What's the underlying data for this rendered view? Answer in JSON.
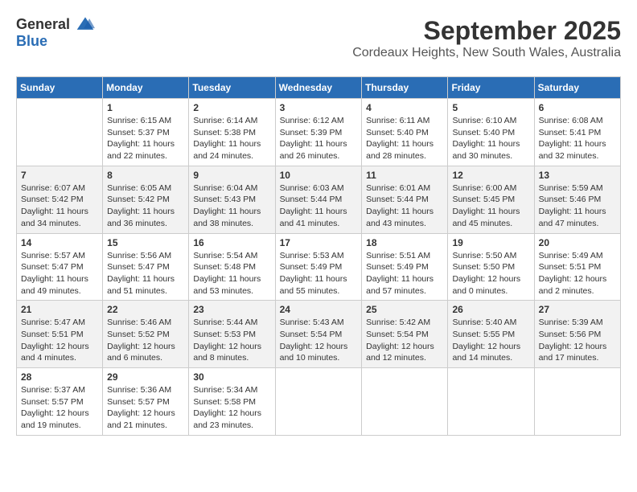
{
  "logo": {
    "line1": "General",
    "line2": "Blue"
  },
  "title": "September 2025",
  "location": "Cordeaux Heights, New South Wales, Australia",
  "days_of_week": [
    "Sunday",
    "Monday",
    "Tuesday",
    "Wednesday",
    "Thursday",
    "Friday",
    "Saturday"
  ],
  "weeks": [
    [
      {
        "day": "",
        "text": ""
      },
      {
        "day": "1",
        "text": "Sunrise: 6:15 AM\nSunset: 5:37 PM\nDaylight: 11 hours\nand 22 minutes."
      },
      {
        "day": "2",
        "text": "Sunrise: 6:14 AM\nSunset: 5:38 PM\nDaylight: 11 hours\nand 24 minutes."
      },
      {
        "day": "3",
        "text": "Sunrise: 6:12 AM\nSunset: 5:39 PM\nDaylight: 11 hours\nand 26 minutes."
      },
      {
        "day": "4",
        "text": "Sunrise: 6:11 AM\nSunset: 5:40 PM\nDaylight: 11 hours\nand 28 minutes."
      },
      {
        "day": "5",
        "text": "Sunrise: 6:10 AM\nSunset: 5:40 PM\nDaylight: 11 hours\nand 30 minutes."
      },
      {
        "day": "6",
        "text": "Sunrise: 6:08 AM\nSunset: 5:41 PM\nDaylight: 11 hours\nand 32 minutes."
      }
    ],
    [
      {
        "day": "7",
        "text": "Sunrise: 6:07 AM\nSunset: 5:42 PM\nDaylight: 11 hours\nand 34 minutes."
      },
      {
        "day": "8",
        "text": "Sunrise: 6:05 AM\nSunset: 5:42 PM\nDaylight: 11 hours\nand 36 minutes."
      },
      {
        "day": "9",
        "text": "Sunrise: 6:04 AM\nSunset: 5:43 PM\nDaylight: 11 hours\nand 38 minutes."
      },
      {
        "day": "10",
        "text": "Sunrise: 6:03 AM\nSunset: 5:44 PM\nDaylight: 11 hours\nand 41 minutes."
      },
      {
        "day": "11",
        "text": "Sunrise: 6:01 AM\nSunset: 5:44 PM\nDaylight: 11 hours\nand 43 minutes."
      },
      {
        "day": "12",
        "text": "Sunrise: 6:00 AM\nSunset: 5:45 PM\nDaylight: 11 hours\nand 45 minutes."
      },
      {
        "day": "13",
        "text": "Sunrise: 5:59 AM\nSunset: 5:46 PM\nDaylight: 11 hours\nand 47 minutes."
      }
    ],
    [
      {
        "day": "14",
        "text": "Sunrise: 5:57 AM\nSunset: 5:47 PM\nDaylight: 11 hours\nand 49 minutes."
      },
      {
        "day": "15",
        "text": "Sunrise: 5:56 AM\nSunset: 5:47 PM\nDaylight: 11 hours\nand 51 minutes."
      },
      {
        "day": "16",
        "text": "Sunrise: 5:54 AM\nSunset: 5:48 PM\nDaylight: 11 hours\nand 53 minutes."
      },
      {
        "day": "17",
        "text": "Sunrise: 5:53 AM\nSunset: 5:49 PM\nDaylight: 11 hours\nand 55 minutes."
      },
      {
        "day": "18",
        "text": "Sunrise: 5:51 AM\nSunset: 5:49 PM\nDaylight: 11 hours\nand 57 minutes."
      },
      {
        "day": "19",
        "text": "Sunrise: 5:50 AM\nSunset: 5:50 PM\nDaylight: 12 hours\nand 0 minutes."
      },
      {
        "day": "20",
        "text": "Sunrise: 5:49 AM\nSunset: 5:51 PM\nDaylight: 12 hours\nand 2 minutes."
      }
    ],
    [
      {
        "day": "21",
        "text": "Sunrise: 5:47 AM\nSunset: 5:51 PM\nDaylight: 12 hours\nand 4 minutes."
      },
      {
        "day": "22",
        "text": "Sunrise: 5:46 AM\nSunset: 5:52 PM\nDaylight: 12 hours\nand 6 minutes."
      },
      {
        "day": "23",
        "text": "Sunrise: 5:44 AM\nSunset: 5:53 PM\nDaylight: 12 hours\nand 8 minutes."
      },
      {
        "day": "24",
        "text": "Sunrise: 5:43 AM\nSunset: 5:54 PM\nDaylight: 12 hours\nand 10 minutes."
      },
      {
        "day": "25",
        "text": "Sunrise: 5:42 AM\nSunset: 5:54 PM\nDaylight: 12 hours\nand 12 minutes."
      },
      {
        "day": "26",
        "text": "Sunrise: 5:40 AM\nSunset: 5:55 PM\nDaylight: 12 hours\nand 14 minutes."
      },
      {
        "day": "27",
        "text": "Sunrise: 5:39 AM\nSunset: 5:56 PM\nDaylight: 12 hours\nand 17 minutes."
      }
    ],
    [
      {
        "day": "28",
        "text": "Sunrise: 5:37 AM\nSunset: 5:57 PM\nDaylight: 12 hours\nand 19 minutes."
      },
      {
        "day": "29",
        "text": "Sunrise: 5:36 AM\nSunset: 5:57 PM\nDaylight: 12 hours\nand 21 minutes."
      },
      {
        "day": "30",
        "text": "Sunrise: 5:34 AM\nSunset: 5:58 PM\nDaylight: 12 hours\nand 23 minutes."
      },
      {
        "day": "",
        "text": ""
      },
      {
        "day": "",
        "text": ""
      },
      {
        "day": "",
        "text": ""
      },
      {
        "day": "",
        "text": ""
      }
    ]
  ]
}
